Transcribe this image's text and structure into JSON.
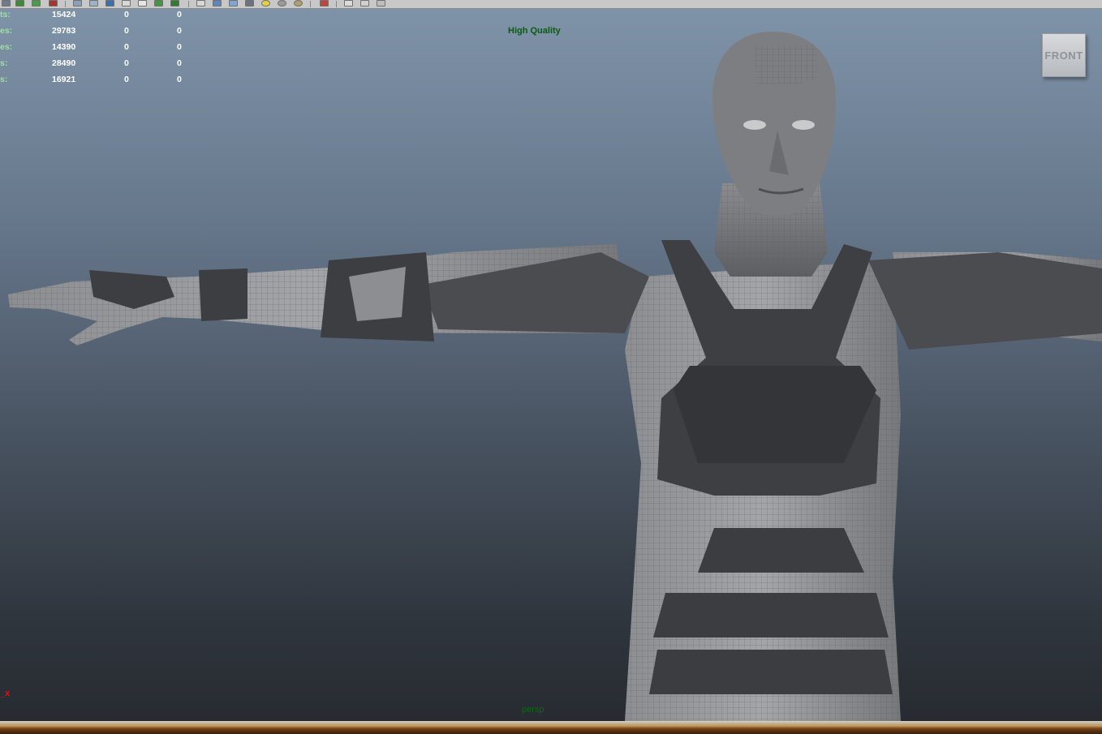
{
  "toolbar": {
    "icons": [
      "layer-icon",
      "table-icon",
      "paint-icon",
      "brush-icon",
      "shade-icon",
      "uv-icon",
      "render-icon",
      "camera-icon",
      "grid-icon",
      "select-icon",
      "snap-icon",
      "isolate-icon",
      "wire-icon",
      "smooth-icon",
      "texture-icon",
      "light-icon",
      "shadow-icon",
      "ao-icon",
      "selection-icon",
      "manip-icon",
      "film-icon",
      "tools-icon"
    ]
  },
  "hud": {
    "rows": [
      {
        "label": "ts:",
        "v1": "15424",
        "v2": "0",
        "v3": "0"
      },
      {
        "label": "es:",
        "v1": "29783",
        "v2": "0",
        "v3": "0"
      },
      {
        "label": "es:",
        "v1": "14390",
        "v2": "0",
        "v3": "0"
      },
      {
        "label": "s:",
        "v1": "28490",
        "v2": "0",
        "v3": "0"
      },
      {
        "label": "s:",
        "v1": "16921",
        "v2": "0",
        "v3": "0"
      }
    ]
  },
  "viewport": {
    "quality_label": "High Quality",
    "viewcube_label": "FRONT",
    "axis_label": "_x",
    "camera_name": "persp"
  },
  "colors": {
    "hud_label": "#9fe09f",
    "hud_value": "#ffffff",
    "quality_text": "#0a5a12",
    "axis": "#e01010"
  }
}
